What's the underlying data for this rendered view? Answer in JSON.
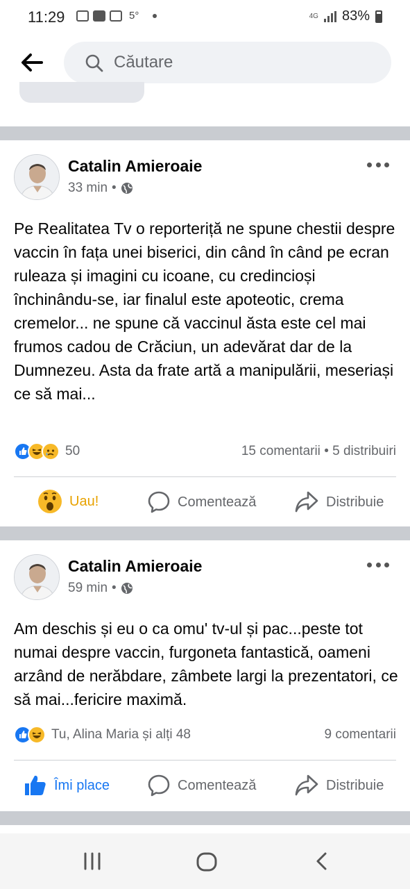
{
  "status_bar": {
    "time": "11:29",
    "temperature": "5°",
    "network": "4G",
    "battery": "83%"
  },
  "search": {
    "placeholder": "Căutare"
  },
  "posts": [
    {
      "author": "Catalin Amieroaie",
      "time": "33 min",
      "separator": "•",
      "text": "Pe Realitatea Tv o reporteriță ne spune chestii despre vaccin în fața unei biserici, din când în când pe ecran ruleaza și imagini cu icoane, cu credincioși închinându-se, iar finalul este apoteotic, crema cremelor... ne spune că vaccinul ăsta este cel mai frumos cadou de Crăciun, un adevărat dar de la Dumnezeu. Asta da frate artă a manipulării, meseriași ce să mai...",
      "reactions": [
        "like",
        "haha",
        "sad"
      ],
      "reaction_count": "50",
      "comments": "15 comentarii",
      "shares": "5 distribuiri",
      "actions": {
        "react": "Uau!",
        "comment": "Comentează",
        "share": "Distribuie"
      }
    },
    {
      "author": "Catalin Amieroaie",
      "time": "59 min",
      "separator": "•",
      "text": "Am deschis și eu o ca omu' tv-ul și pac...peste tot numai despre vaccin, furgoneta fantastică, oameni arzând de nerăbdare,  zâmbete largi la prezentatori, ce să mai...fericire maximă.",
      "reactions": [
        "like",
        "haha"
      ],
      "reaction_count": "Tu, Alina Maria și alți 48",
      "comments": "9 comentarii",
      "actions": {
        "react": "Îmi place",
        "comment": "Comentează",
        "share": "Distribuie"
      }
    }
  ],
  "colors": {
    "facebook_blue": "#1877f2",
    "wow_yellow": "#f7b928",
    "secondary_text": "#65676b",
    "separator": "#c9ccd1"
  },
  "icons": [
    "back-arrow-icon",
    "search-icon",
    "globe-icon",
    "more-icon",
    "wow-icon",
    "comment-icon",
    "share-icon",
    "like-icon",
    "recents-icon",
    "home-icon",
    "back-icon"
  ]
}
